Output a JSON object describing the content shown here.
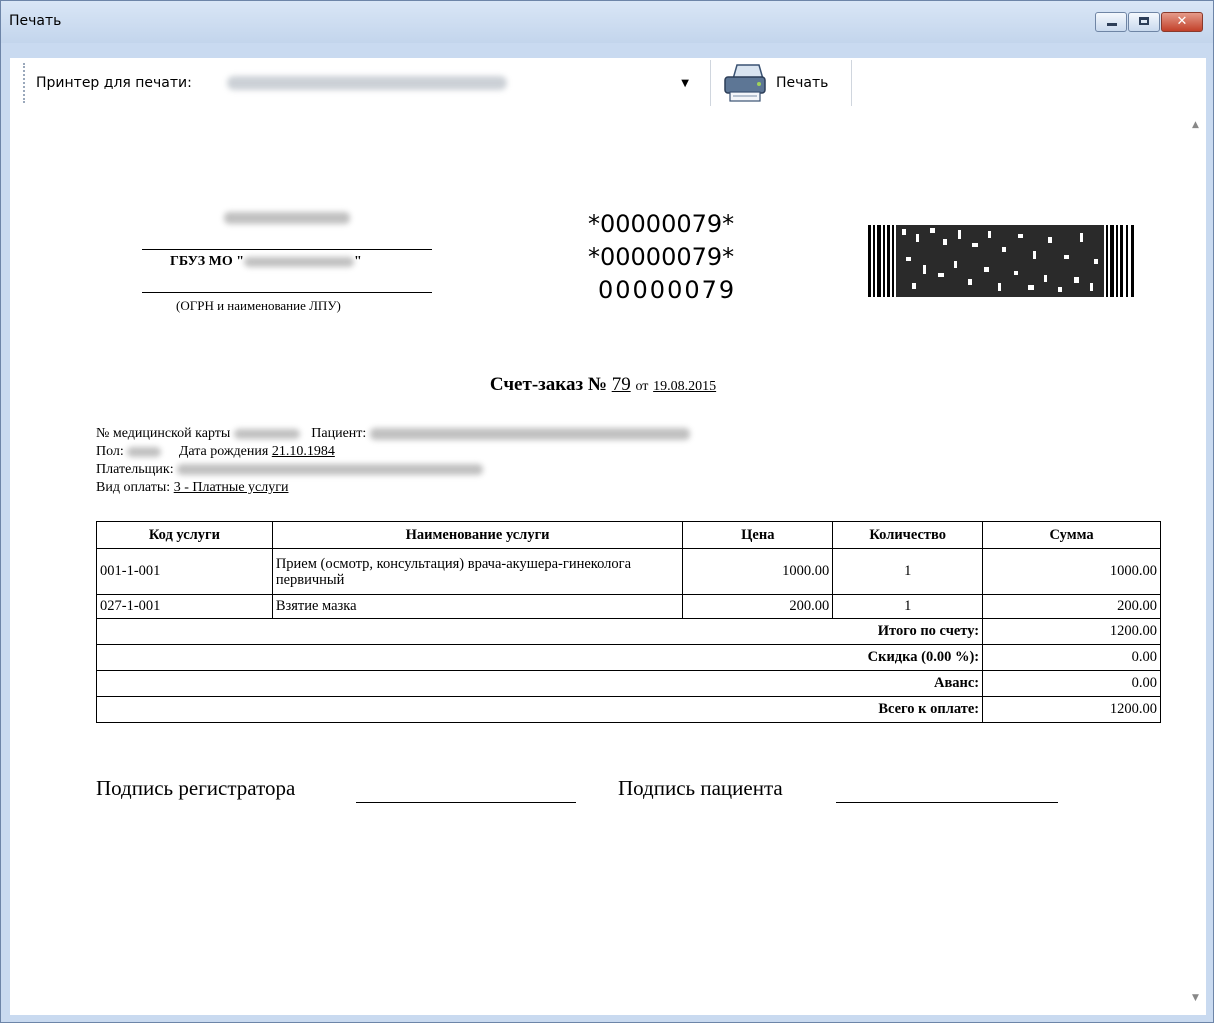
{
  "window": {
    "title": "Печать"
  },
  "toolbar": {
    "printer_label": "Принтер для печати:",
    "print_label": "Печать"
  },
  "document": {
    "org_prefix": "ГБУЗ МО \"",
    "org_suffix": "\"",
    "org_caption": "(ОГРН и наименование ЛПУ)",
    "code_1": "*00000079*",
    "code_2": "*00000079*",
    "code_3": "00000079",
    "heading_prefix": "Счет-заказ №",
    "number": "79",
    "date_prefix": "от",
    "date": "19.08.2015",
    "card_label": "№ медицинской карты",
    "patient_label": "Пациент:",
    "sex_label": "Пол:",
    "dob_label": "Дата рождения",
    "dob": "21.10.1984",
    "payer_label": "Плательщик:",
    "payment_label": "Вид оплаты:",
    "payment_type": "3 - Платные услуги",
    "table": {
      "headers": [
        "Код услуги",
        "Наименование услуги",
        "Цена",
        "Количество",
        "Сумма"
      ],
      "rows": [
        {
          "code": "001-1-001",
          "name": "Прием (осмотр, консультация) врача-акушера-гинеколога первичный",
          "price": "1000.00",
          "qty": "1",
          "sum": "1000.00"
        },
        {
          "code": "027-1-001",
          "name": "Взятие мазка",
          "price": "200.00",
          "qty": "1",
          "sum": "200.00"
        }
      ],
      "totals": [
        {
          "label": "Итого по счету:",
          "value": "1200.00"
        },
        {
          "label": "Скидка (0.00 %):",
          "value": "0.00"
        },
        {
          "label": "Аванс:",
          "value": "0.00"
        },
        {
          "label": "Всего к оплате:",
          "value": "1200.00"
        }
      ]
    },
    "sig_registrar": "Подпись регистратора",
    "sig_patient": "Подпись пациента"
  }
}
